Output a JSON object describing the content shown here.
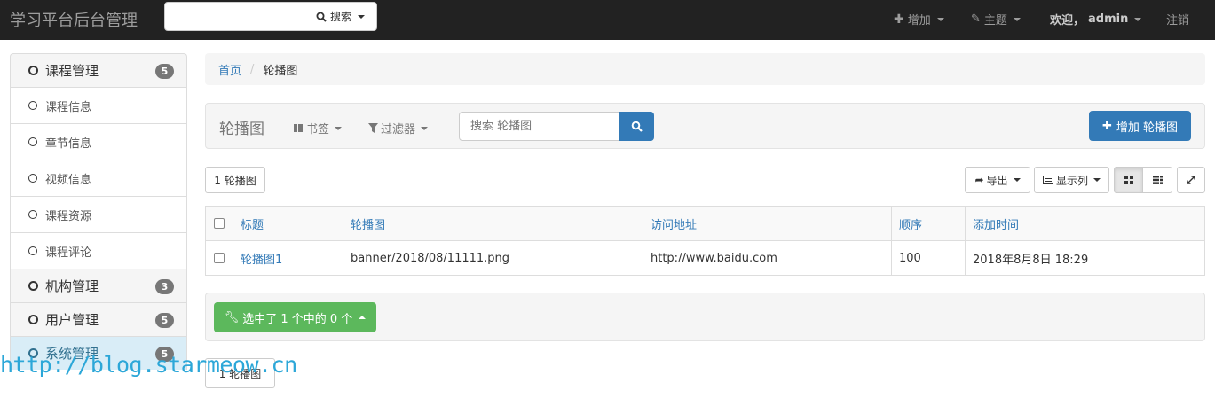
{
  "app": {
    "brand": "学习平台后台管理"
  },
  "topnav": {
    "search_label": "搜索",
    "add_label": "增加",
    "theme_label": "主题",
    "welcome_prefix": "欢迎，",
    "username": "admin",
    "logout_label": "注销"
  },
  "sidebar": {
    "groups": [
      {
        "label": "课程管理",
        "badge": "5"
      },
      {
        "label": "机构管理",
        "badge": "3"
      },
      {
        "label": "用户管理",
        "badge": "5"
      },
      {
        "label": "系统管理",
        "badge": "5"
      }
    ],
    "items": [
      {
        "label": "课程信息"
      },
      {
        "label": "章节信息"
      },
      {
        "label": "视频信息"
      },
      {
        "label": "课程资源"
      },
      {
        "label": "课程评论"
      }
    ]
  },
  "breadcrumb": {
    "home": "首页",
    "current": "轮播图"
  },
  "toolbar": {
    "title": "轮播图",
    "bookmarks_label": "书签",
    "filters_label": "过滤器",
    "search_placeholder": "搜索 轮播图",
    "add_button_label": "增加 轮播图"
  },
  "list": {
    "count_label": "1 轮播图",
    "export_label": "导出",
    "columns_label": "显示列",
    "headers": [
      "标题",
      "轮播图",
      "访问地址",
      "顺序",
      "添加时间"
    ],
    "rows": [
      {
        "title": "轮播图1",
        "image": "banner/2018/08/11111.png",
        "url": "http://www.baidu.com",
        "order": "100",
        "added": "2018年8月8日 18:29"
      }
    ],
    "action_label": "选中了 1 个中的 0 个",
    "footer_count_label": "1 轮播图"
  },
  "watermark": "http://blog.starmeow.cn",
  "colors": {
    "primary": "#337ab7",
    "success": "#5cb85c",
    "navbar": "#222222",
    "watermark": "#2ca7d8"
  }
}
